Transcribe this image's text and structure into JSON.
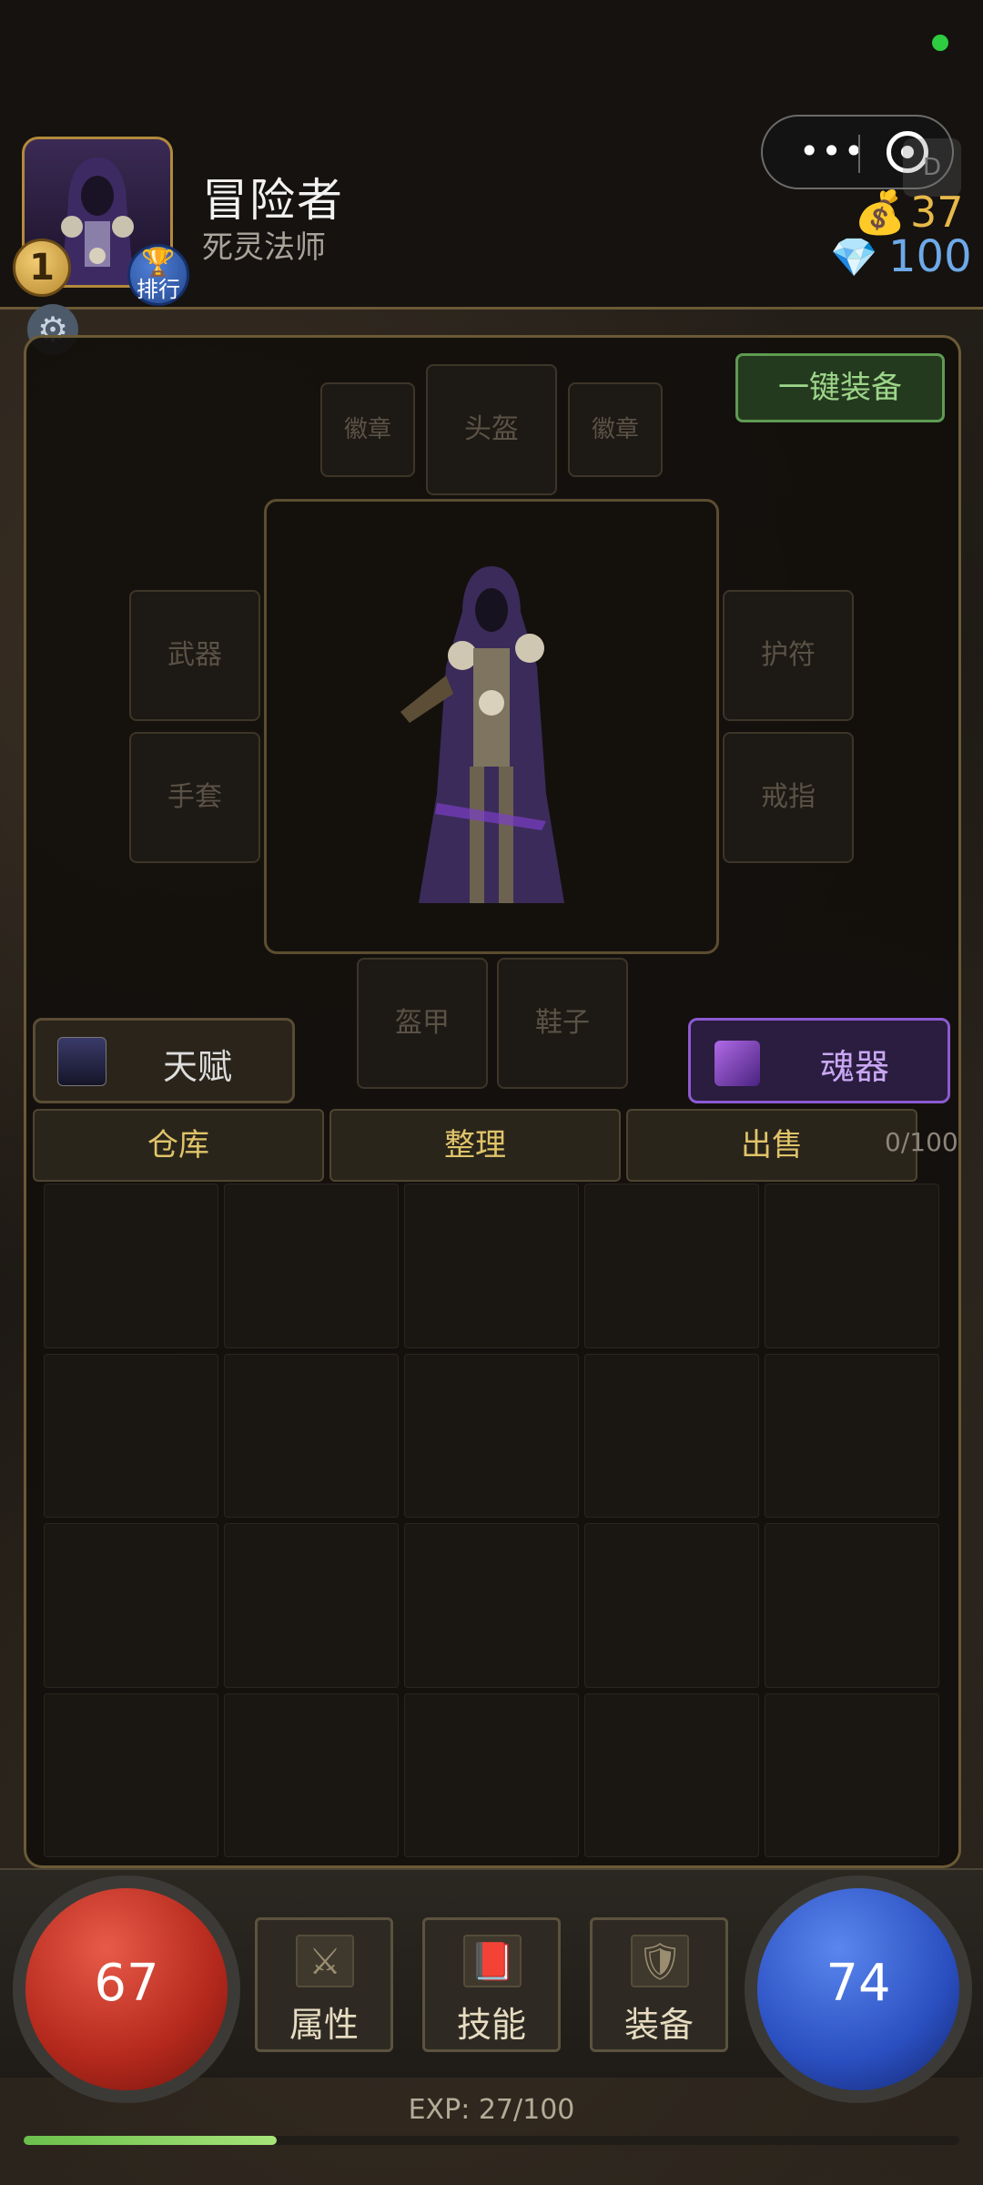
{
  "status": {
    "indicator_color": "#2ecc40"
  },
  "player": {
    "name": "冒险者",
    "class": "死灵法师",
    "level": "1",
    "rank_label": "排行",
    "avatar_icon": "hooded-necromancer-portrait"
  },
  "miniapp": {
    "more_icon": "more-dots-icon",
    "close_icon": "target-close-icon",
    "d_label": "D"
  },
  "currency": {
    "gold_icon": "money-bag-icon",
    "gold": "37",
    "gems_icon": "diamond-icon",
    "gems": "100"
  },
  "equipment": {
    "auto_equip_label": "一键装备",
    "slots": {
      "badge_left": "徽章",
      "helmet": "头盔",
      "badge_right": "徽章",
      "weapon": "武器",
      "amulet": "护符",
      "gloves": "手套",
      "ring": "戒指",
      "armor": "盔甲",
      "boots": "鞋子"
    }
  },
  "buttons": {
    "talent": "天赋",
    "soul": "魂器",
    "warehouse": "仓库",
    "sort": "整理",
    "sell": "出售"
  },
  "inventory": {
    "count": "0/100",
    "rows": 4,
    "cols": 5
  },
  "hud": {
    "hp": "67",
    "mp": "74",
    "attributes": "属性",
    "skills": "技能",
    "equipment": "装备",
    "exp_text": "EXP: 27/100",
    "exp_progress": 0.27
  },
  "colors": {
    "hp": "#b3281c",
    "mp": "#2a4fc0",
    "gold": "#e7b949",
    "accent_green": "#9dd68a",
    "soul_purple": "#8c5ad2"
  }
}
